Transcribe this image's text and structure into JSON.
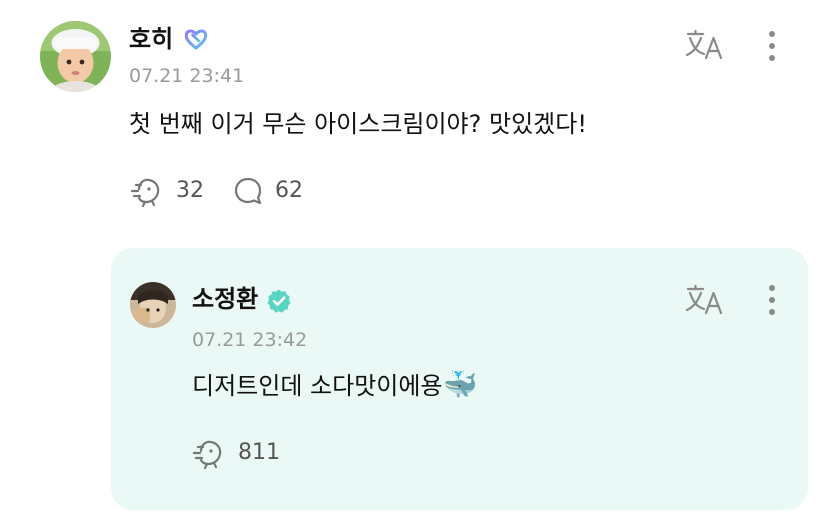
{
  "post": {
    "author": "호히",
    "timestamp": "07.21 23:41",
    "text": "첫 번째 이거 무슨 아이스크림이야? 맛있겠다!",
    "like_count": "32",
    "comment_count": "62",
    "badge_icon": "heart-outline-badge-icon",
    "translate_icon": "translate-icon",
    "more_icon": "more-vertical-icon"
  },
  "reply": {
    "author": "소정환",
    "timestamp": "07.21 23:42",
    "text": "디저트인데 소다맛이에용",
    "emoji": "🐳",
    "like_count": "811",
    "badge_icon": "verified-badge-icon",
    "translate_icon": "translate-icon",
    "more_icon": "more-vertical-icon"
  },
  "colors": {
    "reply_background": "#eaf9f6",
    "verified_badge": "#55d6c2",
    "heart_badge_gradient": [
      "#8a7cf6",
      "#5cc8f0"
    ],
    "muted_text": "#9a9a9a",
    "icon_gray": "#777777"
  }
}
